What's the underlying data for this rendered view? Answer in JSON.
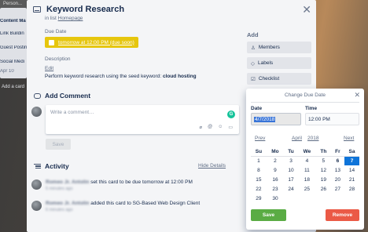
{
  "board": {
    "tab_label": "Person...",
    "list_items": [
      "Content Ma",
      "Link Buildin",
      "Guest Postin",
      "Social Medi",
      "Apr 10",
      "Add a card"
    ]
  },
  "card": {
    "title": "Keyword Research",
    "in_list_prefix": "in list",
    "list_name": "Homepage",
    "close_icon": "close-icon",
    "due_date_label": "Due Date",
    "due_date_value": "tomorrow at 12:00 PM (due soon)",
    "due_color": "#e6c60d",
    "description_label": "Description",
    "edit_label": "Edit",
    "description_prefix": "Perform keyword research using the seed keyword:",
    "description_keyword": "cloud hosting"
  },
  "comment": {
    "heading": "Add Comment",
    "placeholder": "Write a comment…",
    "save_label": "Save",
    "toolbar_icons": [
      "attach-icon",
      "mention-icon",
      "emoji-icon",
      "card-icon"
    ]
  },
  "activity": {
    "heading": "Activity",
    "hide_details": "Hide Details",
    "items": [
      {
        "user": "Romeo Jr. Antolin",
        "text": "set this card to be due tomorrow at 12:00 PM",
        "time": "5 minutes ago"
      },
      {
        "user": "Romeo Jr. Antolin",
        "text": "added this card to SG-Based Web Design Client",
        "time": "6 minutes ago"
      }
    ]
  },
  "sidebar": {
    "add_title": "Add",
    "buttons": [
      {
        "label": "Members",
        "icon": "person-icon"
      },
      {
        "label": "Labels",
        "icon": "tag-icon"
      },
      {
        "label": "Checklist",
        "icon": "checkbox-icon"
      }
    ]
  },
  "due_popover": {
    "title": "Change Due Date",
    "date_label": "Date",
    "time_label": "Time",
    "date_value": "4/7/2018",
    "time_value": "12:00 PM",
    "prev_label": "Prev",
    "month": "April",
    "year": "2018",
    "next_label": "Next",
    "weekdays": [
      "Su",
      "Mo",
      "Tu",
      "We",
      "Th",
      "Fr",
      "Sa"
    ],
    "weeks": [
      [
        "1",
        "2",
        "3",
        "4",
        "5",
        "6",
        "7"
      ],
      [
        "8",
        "9",
        "10",
        "11",
        "12",
        "13",
        "14"
      ],
      [
        "15",
        "16",
        "17",
        "18",
        "19",
        "20",
        "21"
      ],
      [
        "22",
        "23",
        "24",
        "25",
        "26",
        "27",
        "28"
      ],
      [
        "29",
        "30",
        "",
        "",
        "",
        "",
        ""
      ]
    ],
    "selected_day": "7",
    "today_day": "6",
    "save_label": "Save",
    "remove_label": "Remove",
    "save_color": "#5aac44",
    "remove_color": "#eb5a46"
  }
}
